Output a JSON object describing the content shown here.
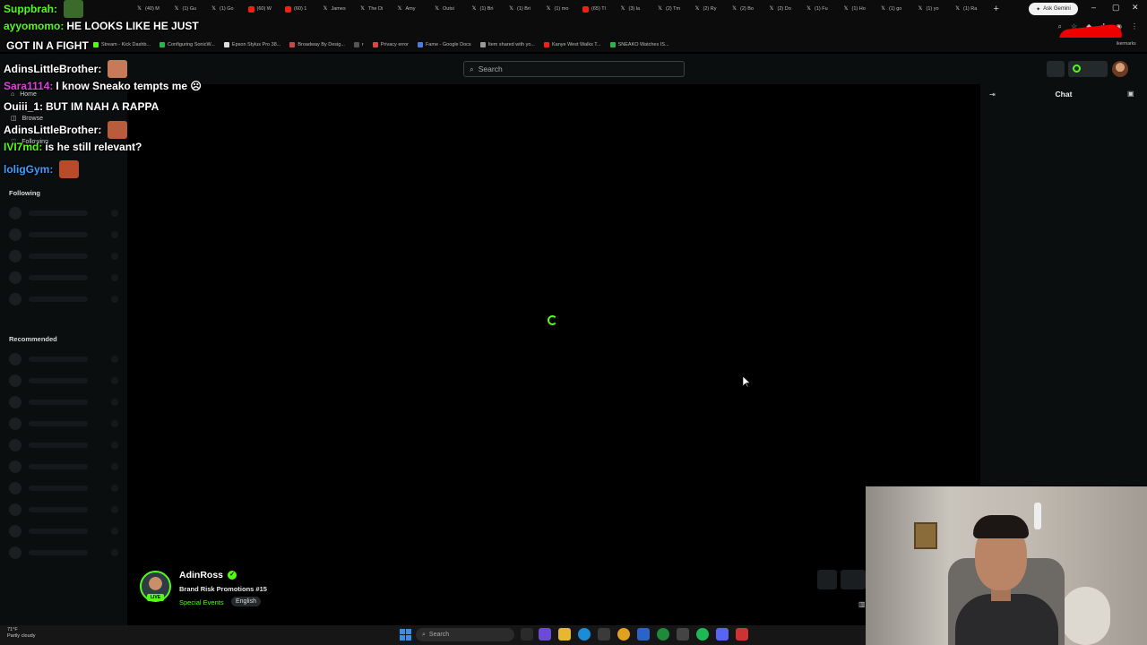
{
  "browser": {
    "tabs": [
      {
        "label": "(40) M",
        "icon": "x"
      },
      {
        "label": "(1) Gu",
        "icon": "x"
      },
      {
        "label": "(1) Go",
        "icon": "x"
      },
      {
        "label": "(60) W",
        "icon": "yt"
      },
      {
        "label": "(60) 1",
        "icon": "yt"
      },
      {
        "label": "James",
        "icon": "x"
      },
      {
        "label": "The Di",
        "icon": "x"
      },
      {
        "label": "Amy ",
        "icon": "x"
      },
      {
        "label": "Outsi",
        "icon": "x"
      },
      {
        "label": "(1) Bri",
        "icon": "x"
      },
      {
        "label": "(1) Bri",
        "icon": "x"
      },
      {
        "label": "(1) mo",
        "icon": "x"
      },
      {
        "label": "(65) Tl",
        "icon": "yt"
      },
      {
        "label": "(3) la",
        "icon": "x"
      },
      {
        "label": "(2) Tm",
        "icon": "x"
      },
      {
        "label": "(2) Ry",
        "icon": "x"
      },
      {
        "label": "(2) Bo",
        "icon": "x"
      },
      {
        "label": "(2) Do",
        "icon": "x"
      },
      {
        "label": "(1) Fu",
        "icon": "x"
      },
      {
        "label": "(1) Ho",
        "icon": "x"
      },
      {
        "label": "(1) go",
        "icon": "x"
      },
      {
        "label": "(1) yo",
        "icon": "x"
      },
      {
        "label": "(1) Ra",
        "icon": "x"
      }
    ],
    "new_tab_symbol": "+",
    "ask_gemini_label": "Ask Gemini",
    "window_controls": {
      "minimize": "–",
      "restore": "▢",
      "close": "✕"
    },
    "bookmarks": [
      {
        "label": "Stream - Kick Dashb...",
        "color": "#53fc18"
      },
      {
        "label": "Configuring SonicW...",
        "color": "#2bb24c"
      },
      {
        "label": "Epson Stylus Pro 38...",
        "color": "#dddddd"
      },
      {
        "label": "Broadway By Desig...",
        "color": "#c44"
      },
      {
        "label": "r",
        "color": "#555555"
      },
      {
        "label": "Privacy error",
        "color": "#d44"
      },
      {
        "label": "Fame - Google Docs",
        "color": "#4a7de0"
      },
      {
        "label": "Item shared with yo...",
        "color": "#999999"
      },
      {
        "label": "Kanye West Walks T...",
        "color": "#e21"
      },
      {
        "label": "SNEAKO Watches IS...",
        "color": "#2bb24c"
      }
    ],
    "profile_label": "ikermarks"
  },
  "stream_chat_overlay": [
    {
      "user": "Suppbrah:",
      "user_color": "#53fc18",
      "message": "",
      "emote": true
    },
    {
      "user": "ayyomomo:",
      "user_color": "#53fc18",
      "message": "HE LOOKS LIKE HE JUST",
      "emote": false
    },
    {
      "user": "",
      "user_color": "#ffffff",
      "message": "GOT IN A FIGHT",
      "emote": false
    },
    {
      "user": "AdinsLittleBrother:",
      "user_color": "#ffffff",
      "message": "",
      "emote": true
    },
    {
      "user": "Sara1114:",
      "user_color": "#e040e0",
      "message": "I know Sneako tempts me ☹",
      "emote": false
    },
    {
      "user": "Ouiii_1:",
      "user_color": "#ffffff",
      "message": "BUT IM NAH A RAPPA",
      "emote": false
    },
    {
      "user": "AdinsLittleBrother:",
      "user_color": "#ffffff",
      "message": "",
      "emote": true
    },
    {
      "user": "IVI7md:",
      "user_color": "#53fc18",
      "message": "is he still relevant?",
      "emote": false
    },
    {
      "user": "loligGym:",
      "user_color": "#3aa0ff",
      "message": "",
      "emote": true
    }
  ],
  "kick": {
    "search_placeholder": "Search",
    "nav": {
      "home": "Home",
      "browse": "Browse",
      "following": "Following"
    },
    "sections": {
      "following": "Following",
      "recommended": "Recommended"
    },
    "chat_title": "Chat"
  },
  "channel": {
    "name": "AdinRoss",
    "live_label": "LIVE",
    "stream_title": "Brand Risk Promotions #15",
    "category": "Special Events",
    "tag": "English"
  },
  "taskbar": {
    "weather_temp": "71°F",
    "weather_desc": "Partly cloudy",
    "search_placeholder": "Search"
  },
  "colors": {
    "kick_green": "#53fc18",
    "panel_bg": "#0b0e0f"
  }
}
